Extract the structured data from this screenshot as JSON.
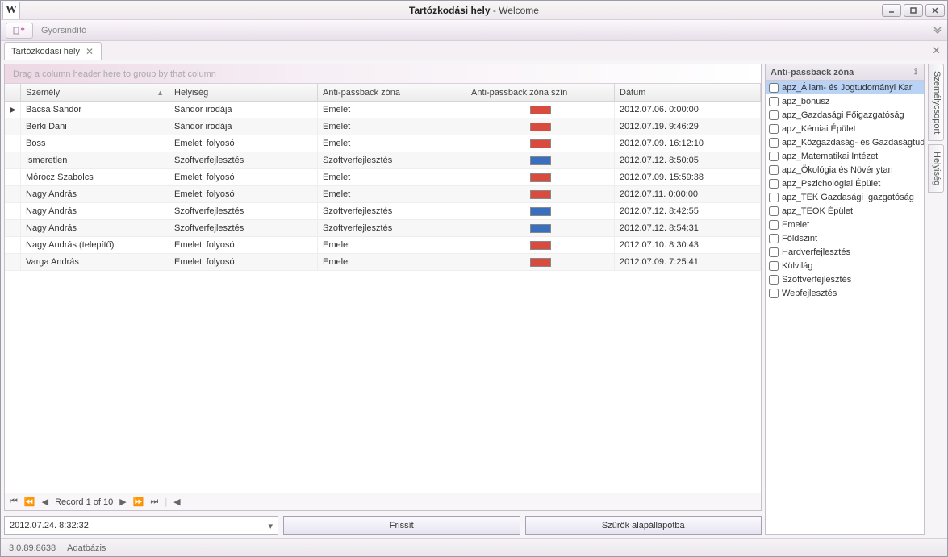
{
  "window": {
    "title_bold": "Tartózkodási hely",
    "title_rest": " - Welcome",
    "app_icon_letter": "W"
  },
  "quicklaunch": {
    "label": "Gyorsindító"
  },
  "tab": {
    "label": "Tartózkodási hely"
  },
  "groupbox_hint": "Drag a column header here to group by that column",
  "columns": {
    "person": "Személy",
    "room": "Helyiség",
    "zone": "Anti-passback zóna",
    "zone_color": "Anti-passback zóna szín",
    "date": "Dátum"
  },
  "rows": [
    {
      "person": "Bacsa Sándor",
      "room": "Sándor irodája",
      "zone": "Emelet",
      "zone_color": "#d84b3e",
      "date": "2012.07.06. 0:00:00",
      "selected": true
    },
    {
      "person": "Berki Dani",
      "room": "Sándor irodája",
      "zone": "Emelet",
      "zone_color": "#d84b3e",
      "date": "2012.07.19. 9:46:29"
    },
    {
      "person": "Boss",
      "room": "Emeleti folyosó",
      "zone": "Emelet",
      "zone_color": "#d84b3e",
      "date": "2012.07.09. 16:12:10"
    },
    {
      "person": "Ismeretlen",
      "room": "Szoftverfejlesztés",
      "zone": "Szoftverfejlesztés",
      "zone_color": "#3a6fbf",
      "date": "2012.07.12. 8:50:05"
    },
    {
      "person": "Mórocz Szabolcs",
      "room": "Emeleti folyosó",
      "zone": "Emelet",
      "zone_color": "#d84b3e",
      "date": "2012.07.09. 15:59:38"
    },
    {
      "person": "Nagy András",
      "room": "Emeleti folyosó",
      "zone": "Emelet",
      "zone_color": "#d84b3e",
      "date": "2012.07.11. 0:00:00"
    },
    {
      "person": "Nagy András",
      "room": "Szoftverfejlesztés",
      "zone": "Szoftverfejlesztés",
      "zone_color": "#3a6fbf",
      "date": "2012.07.12. 8:42:55"
    },
    {
      "person": "Nagy András",
      "room": "Szoftverfejlesztés",
      "zone": "Szoftverfejlesztés",
      "zone_color": "#3a6fbf",
      "date": "2012.07.12. 8:54:31"
    },
    {
      "person": "Nagy András (telepítő)",
      "room": "Emeleti folyosó",
      "zone": "Emelet",
      "zone_color": "#d84b3e",
      "date": "2012.07.10. 8:30:43"
    },
    {
      "person": "Varga András",
      "room": "Emeleti folyosó",
      "zone": "Emelet",
      "zone_color": "#d84b3e",
      "date": "2012.07.09. 7:25:41"
    }
  ],
  "pager": {
    "text": "Record 1 of 10"
  },
  "datefield": {
    "value": "2012.07.24. 8:32:32"
  },
  "buttons": {
    "refresh": "Frissít",
    "reset_filters": "Szűrők alapállapotba"
  },
  "right_panel": {
    "title": "Anti-passback zóna"
  },
  "zones": [
    "apz_Állam- és Jogtudományi Kar",
    "apz_bónusz",
    "apz_Gazdasági Főigazgatóság",
    "apz_Kémiai Épület",
    "apz_Közgazdaság- és Gazdaságtud",
    "apz_Matematikai Intézet",
    "apz_Ökológia és Növénytan",
    "apz_Pszichológiai Épület",
    "apz_TEK Gazdasági Igazgatóság",
    "apz_TEOK Épület",
    "Emelet",
    "Földszint",
    "Hardverfejlesztés",
    "Külvilág",
    "Szoftverfejlesztés",
    "Webfejlesztés"
  ],
  "sidetabs": {
    "szemelycsoport": "Személycsoport",
    "helyiseg": "Helyiség"
  },
  "status": {
    "version": "3.0.89.8638",
    "db": "Adatbázis"
  }
}
